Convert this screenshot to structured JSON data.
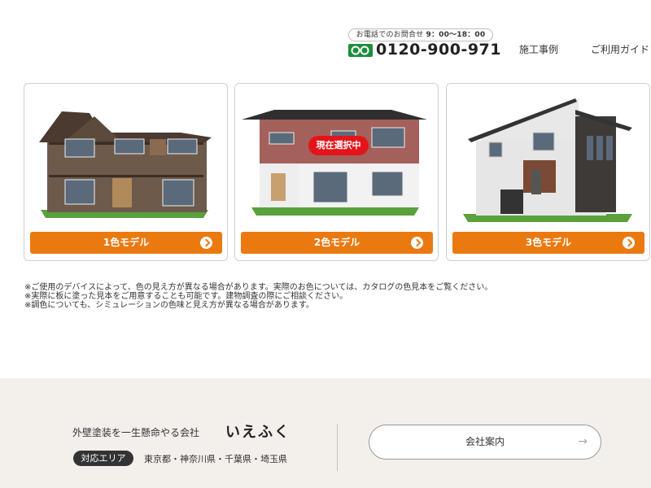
{
  "header": {
    "phone_hours_label": "お電話でのお問合せ",
    "phone_hours_time": "9：00〜18：00",
    "phone_number": "0120-900-971",
    "nav": [
      "施工事例",
      "ご利用ガイド"
    ]
  },
  "models": [
    {
      "label": "1色モデル",
      "selected": false
    },
    {
      "label": "2色モデル",
      "selected": true
    },
    {
      "label": "3色モデル",
      "selected": false
    }
  ],
  "selected_badge": "現在選択中",
  "notes": [
    "※ご使用のデバイスによって、色の見え方が異なる場合があります。実際のお色については、カタログの色見本をご覧ください。",
    "※実際に板に塗った見本をご用意することも可能です。建物調査の際にご相談ください。",
    "※調色についても、シミュレーションの色味と見え方が異なる場合があります。"
  ],
  "footer": {
    "tagline": "外壁塗装を一生懸命やる会社",
    "brand": "いえふく",
    "area_badge": "対応エリア",
    "area_list": "東京都・神奈川県・千葉県・埼玉県",
    "company_button": "会社案内"
  },
  "colors": {
    "accent": "#ea7a10",
    "badge_red": "#e3151a",
    "footer_bg": "#f3efeb"
  }
}
